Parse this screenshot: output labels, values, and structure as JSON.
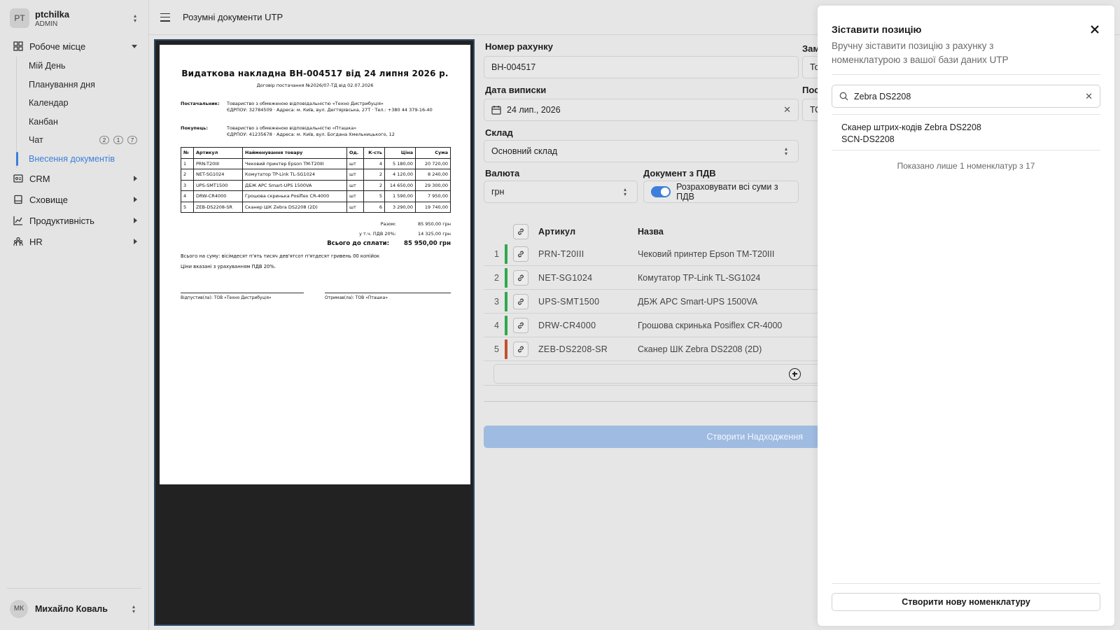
{
  "org": {
    "initials": "PT",
    "name": "ptchilka",
    "role": "ADMIN"
  },
  "nav": {
    "workspace": "Робоче місце",
    "sub": [
      "Мій День",
      "Планування дня",
      "Календар",
      "Канбан",
      "Чат",
      "Внесення документів"
    ],
    "chat_badges": [
      "2",
      "1",
      "7"
    ],
    "crm": "CRM",
    "storage": "Сховище",
    "productivity": "Продуктивність",
    "hr": "HR"
  },
  "user": {
    "initials": "МК",
    "name": "Михайло Коваль"
  },
  "header": {
    "title": "Розумні документи UTP"
  },
  "document": {
    "title": "Видаткова накладна ВН-004517 від 24 липня 2026 р.",
    "contract": "Договір постачання №2026/07-ТД від 02.07.2026",
    "supplier_label": "Постачальник:",
    "supplier": "Товариство з обмеженою відповідальністю «Техно Дистрибуція»",
    "supplier_details": "ЄДРПОУ: 32784509 · Адреса: м. Київ, вул. Дегтярівська, 27Т · Тел.: +380 44 379-16-40",
    "buyer_label": "Покупець:",
    "buyer": "Товариство з обмеженою відповідальністю «Пташка»",
    "buyer_details": "ЄДРПОУ: 41235678 · Адреса: м. Київ, вул. Богдана Хмельницького, 12",
    "table_headers": [
      "№",
      "Артикул",
      "Найменування товару",
      "Од.",
      "К-сть",
      "Ціна",
      "Сума"
    ],
    "rows": [
      [
        "1",
        "PRN-T20III",
        "Чековий принтер Epson TM-T20III",
        "шт",
        "4",
        "5 180,00",
        "20 720,00"
      ],
      [
        "2",
        "NET-SG1024",
        "Комутатор TP-Link TL-SG1024",
        "шт",
        "2",
        "4 120,00",
        "8 240,00"
      ],
      [
        "3",
        "UPS-SMT1500",
        "ДБЖ APC Smart-UPS 1500VA",
        "шт",
        "2",
        "14 650,00",
        "29 300,00"
      ],
      [
        "4",
        "DRW-CR4000",
        "Грошова скринька Posiflex CR-4000",
        "шт",
        "5",
        "1 590,00",
        "7 950,00"
      ],
      [
        "5",
        "ZEB-DS2208-SR",
        "Сканер ШК Zebra DS2208 (2D)",
        "шт",
        "6",
        "3 290,00",
        "19 740,00"
      ]
    ],
    "subtotal_label": "Разом:",
    "subtotal": "85 950,00 грн",
    "vat_label": "у т.ч. ПДВ 20%:",
    "vat": "14 325,00 грн",
    "total_label": "Всього до сплати:",
    "total": "85 950,00 грн",
    "words": "Всього на суму: вісімдесят п'ять тисяч дев'ятсот п'ятдесят гривень 00 копійок",
    "vat_note": "Ціни вказані з урахуванням ПДВ 20%.",
    "released": "Відпустив(ла): ТОВ «Техно Дистрибуція»",
    "received": "Отримав(ла): ТОВ «Пташка»"
  },
  "form": {
    "invoice_label": "Номер рахунку",
    "invoice_value": "ВН-004517",
    "date_label": "Дата виписки",
    "date_value": "24 лип., 2026",
    "warehouse_label": "Склад",
    "warehouse_value": "Основний склад",
    "currency_label": "Валюта",
    "currency_value": "грн",
    "vat_label": "Документ з ПДВ",
    "vat_toggle_label": "Розраховувати всі суми з ПДВ",
    "cut_label_1": "Зам",
    "cut_value_1": "То",
    "cut_label_2": "Пос",
    "cut_value_2": "ТО",
    "col_article": "Артикул",
    "col_name": "Назва",
    "lines": [
      {
        "n": "1",
        "article": "PRN-T20III",
        "name": "Чековий принтер Epson TM-T20III",
        "status_color": "#2fa84f"
      },
      {
        "n": "2",
        "article": "NET-SG1024",
        "name": "Комутатор TP-Link TL-SG1024",
        "status_color": "#2fa84f"
      },
      {
        "n": "3",
        "article": "UPS-SMT1500",
        "name": "ДБЖ APC Smart-UPS 1500VA",
        "status_color": "#2fa84f"
      },
      {
        "n": "4",
        "article": "DRW-CR4000",
        "name": "Грошова скринька Posiflex CR-4000",
        "status_color": "#2fa84f"
      },
      {
        "n": "5",
        "article": "ZEB-DS2208-SR",
        "name": "Сканер ШК Zebra DS2208 (2D)",
        "status_color": "#c4502f"
      }
    ],
    "create_button": "Створити Надходження"
  },
  "panel": {
    "title": "Зіставити позицію",
    "description": "Вручну зіставити позицію з рахунку з номенклатурою з вашої бази даних UTP",
    "search_value": "Zebra DS2208",
    "result_name": "Сканер штрих-кодів Zebra DS2208",
    "result_code": "SCN-DS2208",
    "shown_note": "Показано лише 1 номенклатур з 17",
    "new_button": "Створити нову номенклатуру"
  },
  "colors": {
    "accent": "#3d7fd9",
    "matched": "#2fa84f",
    "unmatched": "#c4502f",
    "disabled_button": "#9fbbe2"
  },
  "icons": [
    "grid-icon",
    "crm-icon",
    "storage-icon",
    "chart-icon",
    "people-icon",
    "calendar-icon",
    "search-icon",
    "link-icon",
    "close-icon",
    "plus-circle-icon"
  ]
}
